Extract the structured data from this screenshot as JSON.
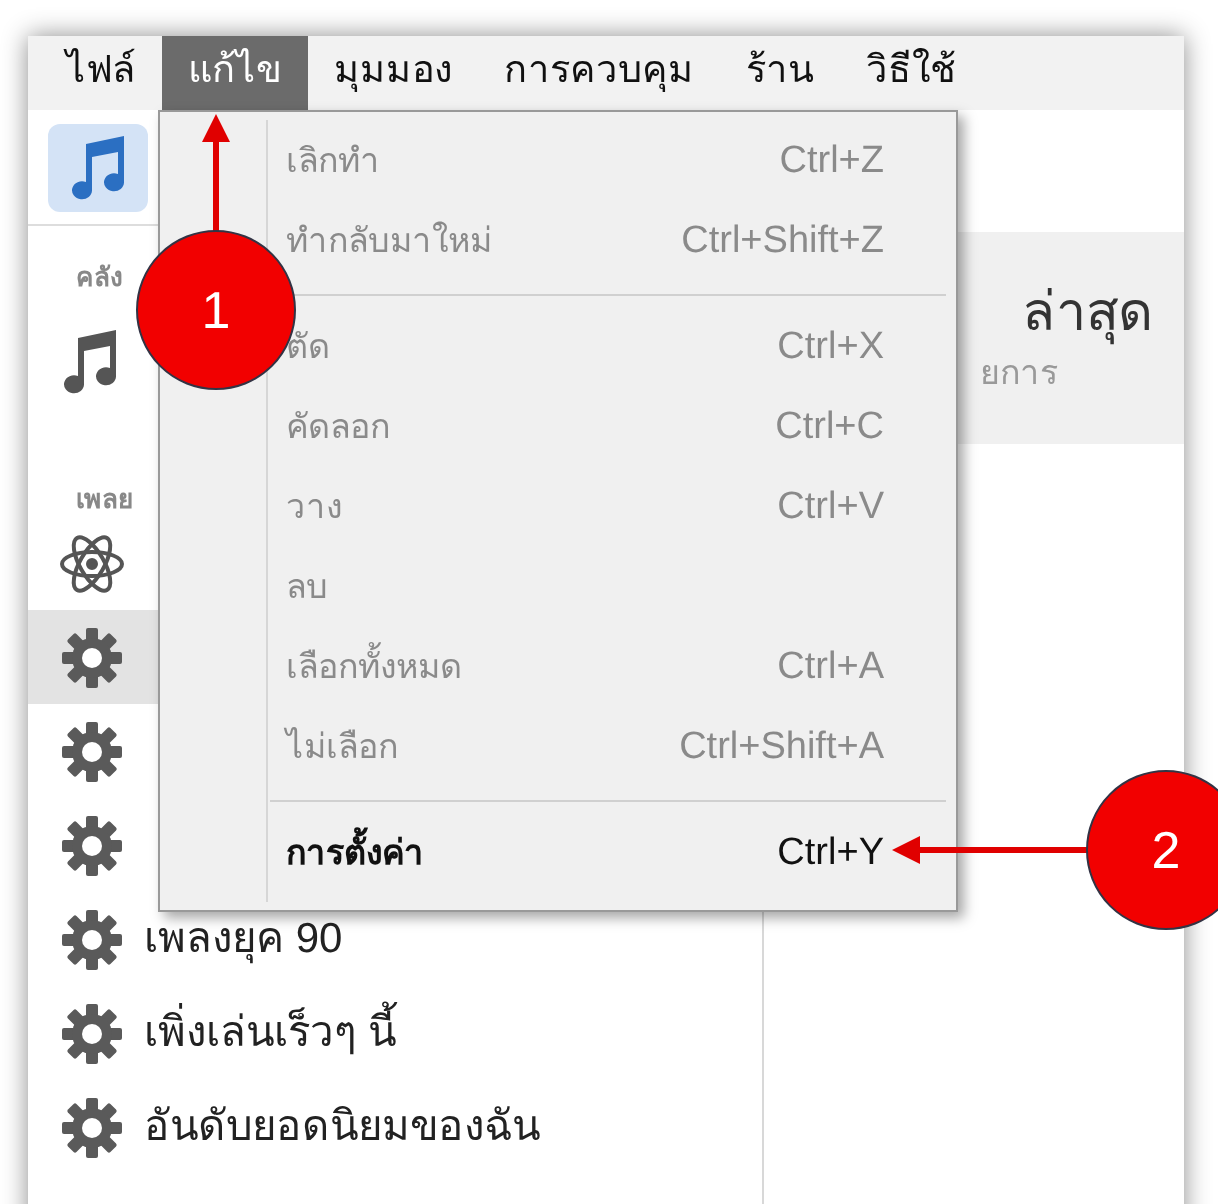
{
  "menu_bar": [
    {
      "label": "ไฟล์",
      "selected": false
    },
    {
      "label": "แก้ไข",
      "selected": true
    },
    {
      "label": "มุมมอง",
      "selected": false
    },
    {
      "label": "การควบคุม",
      "selected": false
    },
    {
      "label": "ร้าน",
      "selected": false
    },
    {
      "label": "วิธีใช้",
      "selected": false
    }
  ],
  "edit_menu": [
    {
      "kind": "item",
      "label": "เลิกทำ",
      "shortcut": "Ctrl+Z",
      "disabled": true
    },
    {
      "kind": "item",
      "label": "ทำกลับมาใหม่",
      "shortcut": "Ctrl+Shift+Z",
      "disabled": true
    },
    {
      "kind": "separator"
    },
    {
      "kind": "item",
      "label": "ตัด",
      "shortcut": "Ctrl+X",
      "disabled": true
    },
    {
      "kind": "item",
      "label": "คัดลอก",
      "shortcut": "Ctrl+C",
      "disabled": true
    },
    {
      "kind": "item",
      "label": "วาง",
      "shortcut": "Ctrl+V",
      "disabled": true
    },
    {
      "kind": "item",
      "label": "ลบ",
      "disabled": true
    },
    {
      "kind": "item",
      "label": "เลือกทั้งหมด",
      "shortcut": "Ctrl+A",
      "disabled": true
    },
    {
      "kind": "item",
      "label": "ไม่เลือก",
      "shortcut": "Ctrl+Shift+A",
      "disabled": true
    },
    {
      "kind": "separator"
    },
    {
      "kind": "item",
      "label": "การตั้งค่า",
      "shortcut": "Ctrl+Y",
      "disabled": false
    }
  ],
  "sidebar": {
    "media_button": {
      "selected": true
    },
    "library_header": "คลัง",
    "library_items": [
      {
        "kind": "note",
        "selected": false
      }
    ],
    "playlists_header": "เพลย",
    "playlists": [
      {
        "kind": "atom",
        "selected": false
      },
      {
        "kind": "gear",
        "selected": true
      },
      {
        "kind": "gear",
        "selected": false
      },
      {
        "kind": "gear",
        "selected": false
      },
      {
        "kind": "gear",
        "label": "เพลงยุค 90",
        "selected": false
      },
      {
        "kind": "gear",
        "label": "เพิ่งเล่นเร็วๆ นี้",
        "selected": false
      },
      {
        "kind": "gear",
        "label": "อันดับยอดนิยมของฉัน",
        "selected": false
      }
    ]
  },
  "content": {
    "heading": "ล่าสุด",
    "subtitle": "ยการ"
  },
  "annotations": [
    {
      "label": "1"
    },
    {
      "label": "2"
    }
  ]
}
